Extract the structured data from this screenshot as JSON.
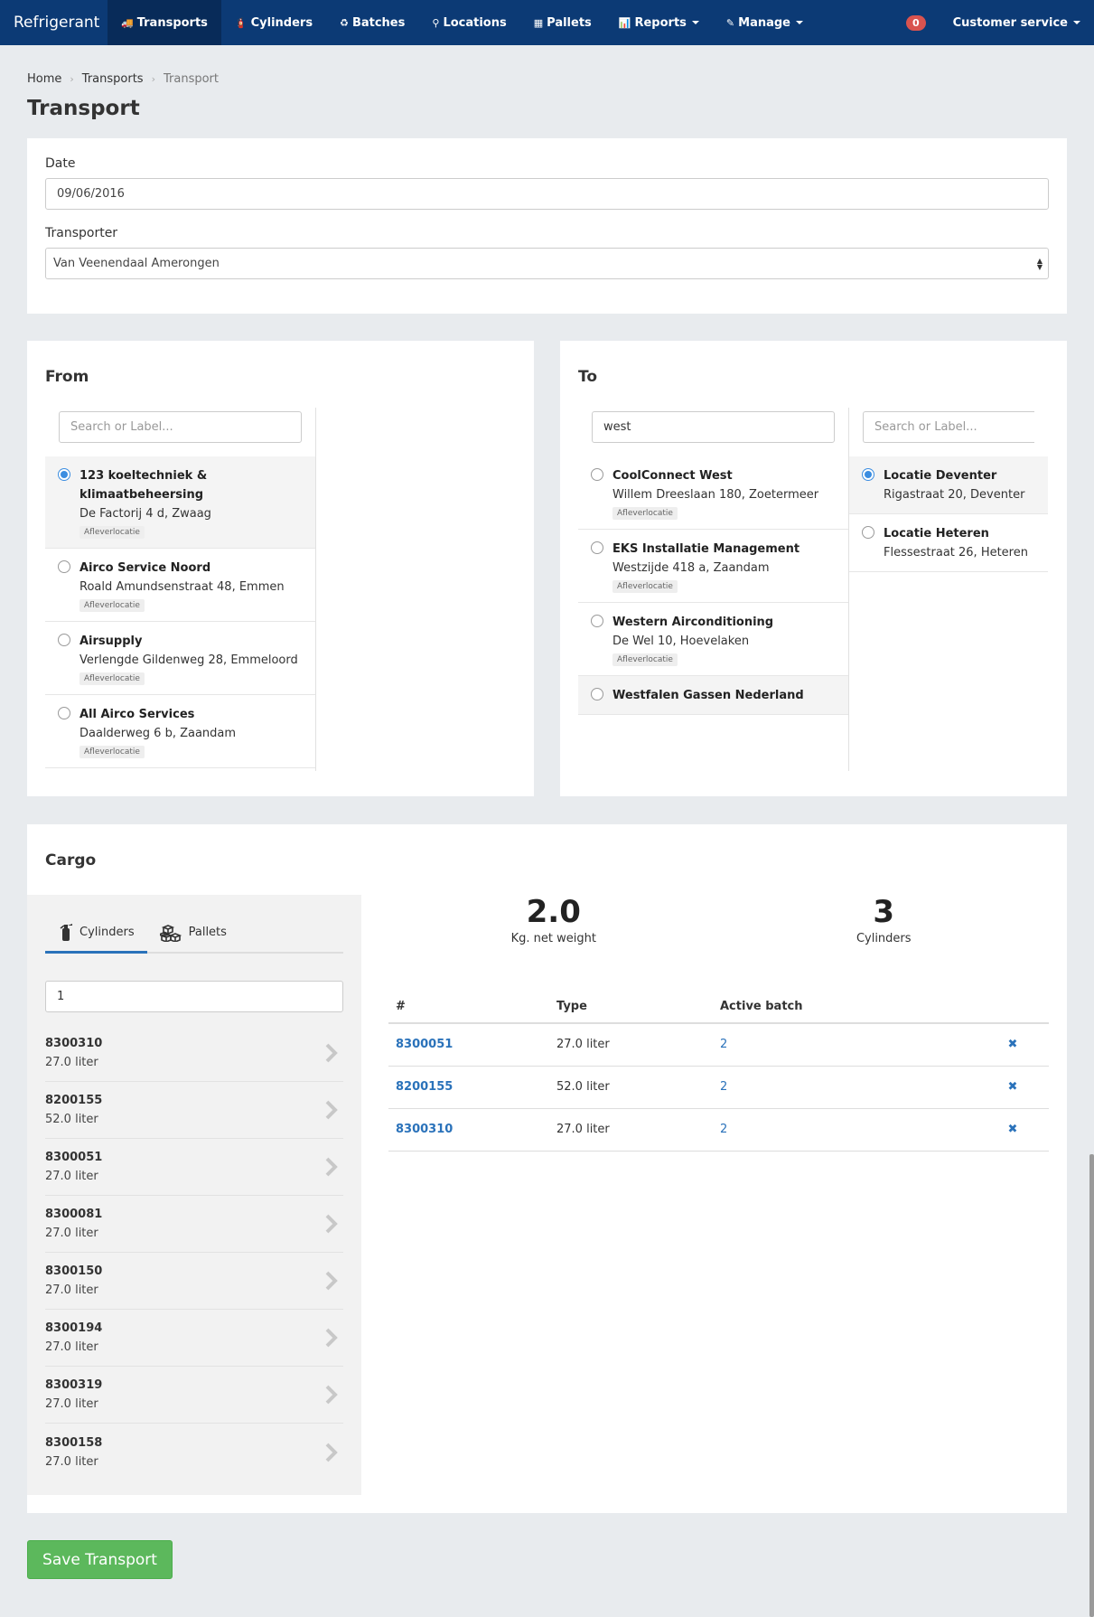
{
  "navbar": {
    "brand": "Refrigerant",
    "items": [
      {
        "label": "Transports",
        "icon": "truck-icon",
        "active": true
      },
      {
        "label": "Cylinders",
        "icon": "fire-extinguisher-icon"
      },
      {
        "label": "Batches",
        "icon": "recycle-icon"
      },
      {
        "label": "Locations",
        "icon": "map-marker-icon"
      },
      {
        "label": "Pallets",
        "icon": "cubes-icon"
      },
      {
        "label": "Reports",
        "icon": "bar-chart-icon",
        "dropdown": true
      },
      {
        "label": "Manage",
        "icon": "edit-icon",
        "dropdown": true
      }
    ],
    "notification_count": "0",
    "user": "Customer service"
  },
  "breadcrumb": {
    "home": "Home",
    "transports": "Transports",
    "current": "Transport"
  },
  "page_title": "Transport",
  "form": {
    "date_label": "Date",
    "date_value": "09/06/2016",
    "transporter_label": "Transporter",
    "transporter_value": "Van Veenendaal Amerongen"
  },
  "from": {
    "title": "From",
    "search_placeholder": "Search or Label...",
    "items": [
      {
        "name": "123 koeltechniek & klimaatbeheersing",
        "address": "De Factorij 4 d, Zwaag",
        "tag": "Afleverlocatie",
        "selected": true
      },
      {
        "name": "Airco Service Noord",
        "address": "Roald Amundsenstraat 48, Emmen",
        "tag": "Afleverlocatie"
      },
      {
        "name": "Airsupply",
        "address": "Verlengde Gildenweg 28, Emmeloord",
        "tag": "Afleverlocatie"
      },
      {
        "name": "All Airco Services",
        "address": "Daalderweg 6 b, Zaandam",
        "tag": "Afleverlocatie"
      }
    ]
  },
  "to": {
    "title": "To",
    "search_value": "west",
    "search_placeholder_2": "Search or Label...",
    "items": [
      {
        "name": "CoolConnect West",
        "address": "Willem Dreeslaan 180, Zoetermeer",
        "tag": "Afleverlocatie"
      },
      {
        "name": "EKS Installatie Management",
        "address": "Westzijde 418 a, Zaandam",
        "tag": "Afleverlocatie"
      },
      {
        "name": "Western Airconditioning",
        "address": "De Wel 10, Hoevelaken",
        "tag": "Afleverlocatie"
      },
      {
        "name": "Westfalen Gassen Nederland",
        "address": "",
        "tag": ""
      }
    ],
    "sublocations": [
      {
        "name": "Locatie Deventer",
        "address": "Rigastraat 20, Deventer",
        "selected": true
      },
      {
        "name": "Locatie Heteren",
        "address": "Flessestraat 26, Heteren"
      }
    ]
  },
  "cargo": {
    "title": "Cargo",
    "tab_cylinders": "Cylinders",
    "tab_pallets": "Pallets",
    "filter_value": "1",
    "available": [
      {
        "number": "8300310",
        "type": "27.0 liter"
      },
      {
        "number": "8200155",
        "type": "52.0 liter"
      },
      {
        "number": "8300051",
        "type": "27.0 liter"
      },
      {
        "number": "8300081",
        "type": "27.0 liter"
      },
      {
        "number": "8300150",
        "type": "27.0 liter"
      },
      {
        "number": "8300194",
        "type": "27.0 liter"
      },
      {
        "number": "8300319",
        "type": "27.0 liter"
      },
      {
        "number": "8300158",
        "type": "27.0 liter"
      }
    ],
    "net_weight_value": "2.0",
    "net_weight_label": "Kg. net weight",
    "cylinders_count": "3",
    "cylinders_label": "Cylinders",
    "table_headers": {
      "num": "#",
      "type": "Type",
      "batch": "Active batch"
    },
    "rows": [
      {
        "number": "8300051",
        "type": "27.0 liter",
        "batch": "2"
      },
      {
        "number": "8200155",
        "type": "52.0 liter",
        "batch": "2"
      },
      {
        "number": "8300310",
        "type": "27.0 liter",
        "batch": "2"
      }
    ],
    "remove_glyph": "✖"
  },
  "save_label": "Save Transport",
  "colors": {
    "navbar": "#0c3a75",
    "navbar_active": "#082b59",
    "link": "#2a72ba",
    "success": "#5cb85c",
    "badge": "#d9534f"
  }
}
